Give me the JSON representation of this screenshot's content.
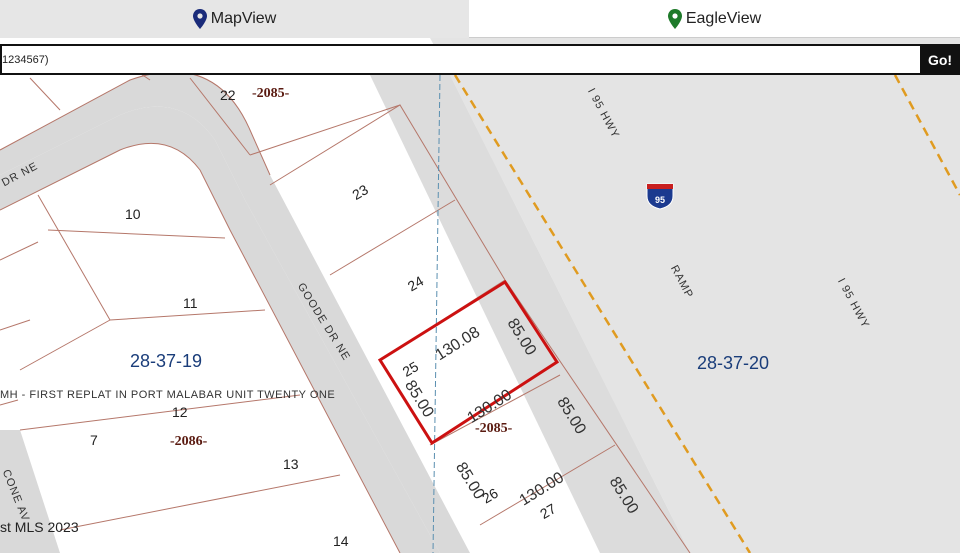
{
  "tabs": {
    "map_view": "MapView",
    "eagle_view": "EagleView"
  },
  "search": {
    "value": "1234567)",
    "go_label": "Go!"
  },
  "colors": {
    "parcel_line": "#b5776a",
    "highlight": "#cc1111",
    "road": "#d9d9d9",
    "highway_dash": "#e09b20",
    "section_text": "#1a3d7a",
    "block_text": "#5a1a10"
  },
  "map": {
    "lots": [
      "22",
      "10",
      "11",
      "12",
      "7",
      "13",
      "14",
      "23",
      "24",
      "25",
      "26",
      "27"
    ],
    "blocks": [
      "-2085-",
      "-2086-",
      "-2085-"
    ],
    "sections": [
      "28-37-19",
      "28-37-20"
    ],
    "streets": {
      "dr_ne": "DR NE",
      "goode": "GOODE DR NE",
      "cone": "CONE AV",
      "hwy_top": "I 95 HWY",
      "hwy_right": "I 95 HWY",
      "ramp": "RAMP"
    },
    "dims": {
      "a": "130.08",
      "b": "85.00",
      "c": "85.00",
      "d": "130.00",
      "e": "85.00",
      "f": "85.00",
      "g": "130.00",
      "h": "85.00"
    },
    "subdivision": "MH - FIRST REPLAT IN PORT MALABAR UNIT TWENTY ONE",
    "shield_number": "95",
    "copyright": "st MLS 2023"
  }
}
